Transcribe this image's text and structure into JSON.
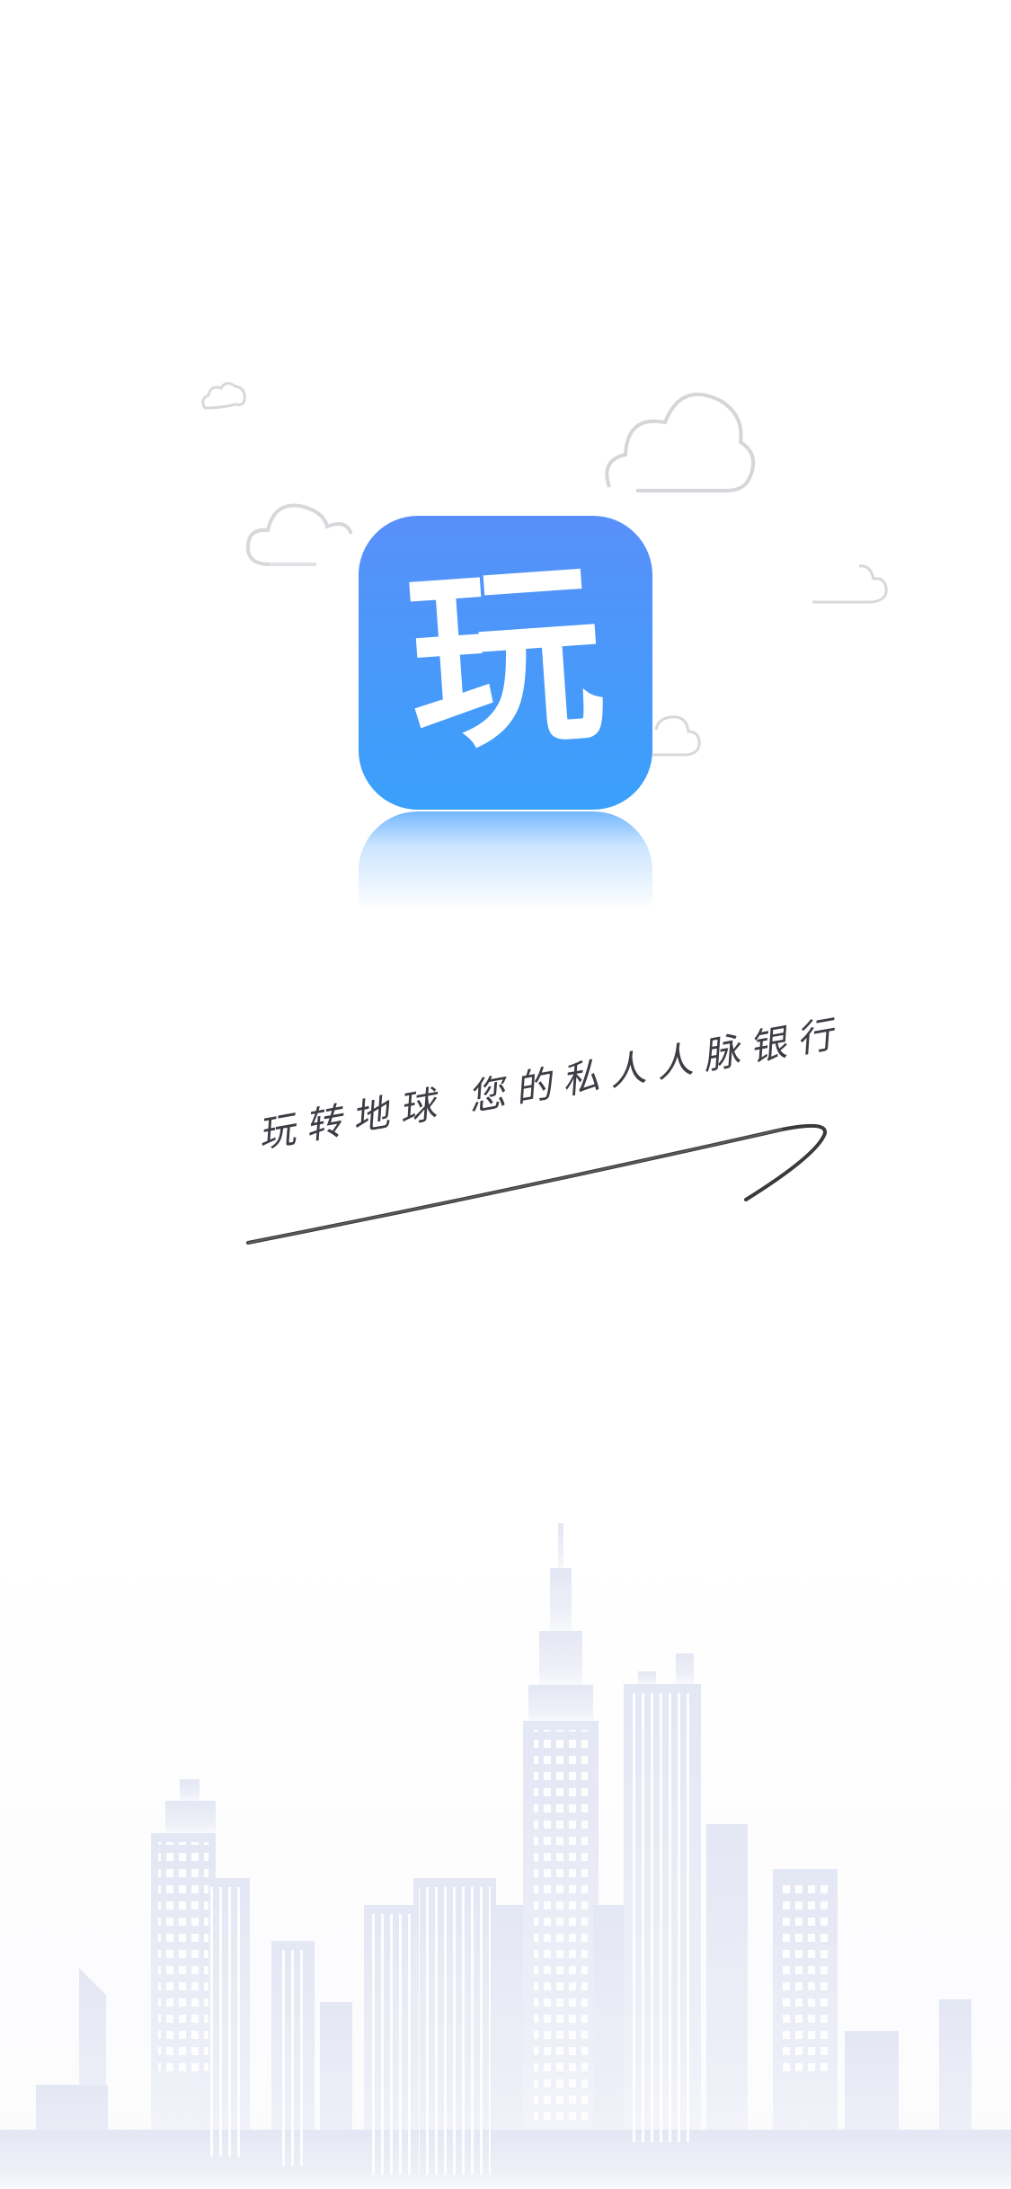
{
  "app": {
    "icon_glyph": "玩",
    "icon_gradient_top": "#5890f9",
    "icon_gradient_bottom": "#3aa0fb"
  },
  "tagline": {
    "text": "玩转地球 您的私人人脉银行"
  },
  "decor": {
    "clouds": "cloud-icon",
    "skyline": "city-skyline-illustration"
  }
}
